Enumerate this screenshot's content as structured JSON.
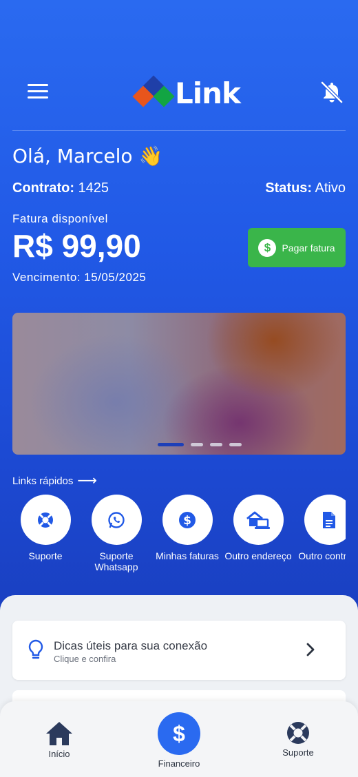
{
  "header": {
    "logo_text": "Link",
    "colors": {
      "hero_top": "#2a6af0",
      "hero_bottom": "#1a3fc0",
      "accent_green": "#3ab54a",
      "logo_blue": "#1f3fa8",
      "logo_orange": "#e8551c",
      "logo_green": "#12a543"
    }
  },
  "greeting": {
    "text": "Olá, Marcelo",
    "emoji": "👋"
  },
  "contract": {
    "label": "Contrato:",
    "value": "1425"
  },
  "status": {
    "label": "Status:",
    "value": "Ativo"
  },
  "bill": {
    "label": "Fatura disponível",
    "amount": "R$ 99,90",
    "due": "Vencimento: 15/05/2025",
    "pay_button": "Pagar fatura"
  },
  "banner": {
    "slides": 4,
    "active_index": 0
  },
  "quick_links": {
    "title": "Links rápidos",
    "items": [
      {
        "label": "Suporte",
        "icon": "lifebuoy-icon"
      },
      {
        "label": "Suporte Whatsapp",
        "icon": "whatsapp-icon"
      },
      {
        "label": "Minhas faturas",
        "icon": "dollar-coin-icon"
      },
      {
        "label": "Outro endereço",
        "icon": "house-laptop-icon"
      },
      {
        "label": "Outro contrato",
        "icon": "document-icon"
      }
    ]
  },
  "tip_card": {
    "title": "Dicas úteis para sua conexão",
    "subtitle": "Clique e confira"
  },
  "bottom_nav": {
    "home": "Início",
    "finance": "Financeiro",
    "support": "Suporte"
  }
}
